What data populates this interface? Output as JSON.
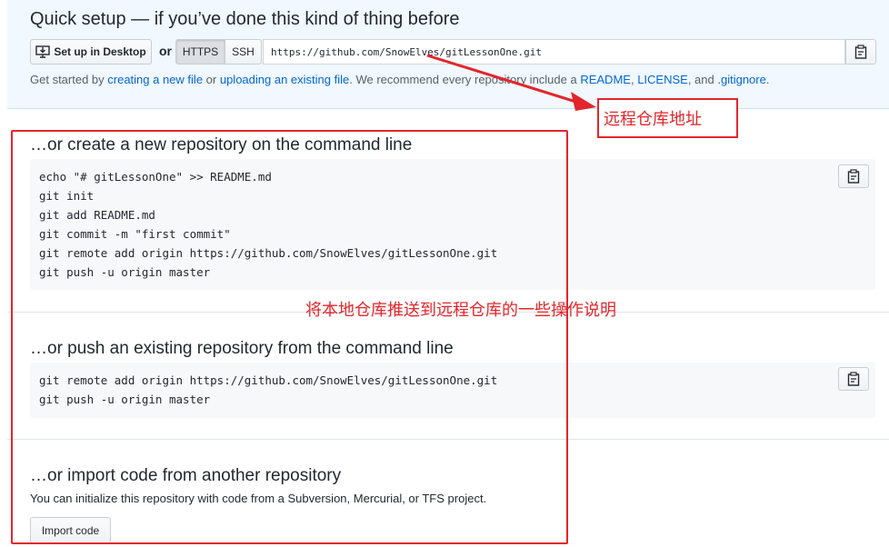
{
  "quick_setup": {
    "title": "Quick setup — if you’ve done this kind of thing before",
    "desktop_button": "Set up in Desktop",
    "or": "or",
    "https_label": "HTTPS",
    "ssh_label": "SSH",
    "clone_url": "https://github.com/SnowElves/gitLessonOne.git",
    "help": {
      "part1": "Get started by ",
      "link_new_file": "creating a new file",
      "part2": " or ",
      "link_upload": "uploading an existing file",
      "part3": ". We recommend every repository include a ",
      "link_readme": "README",
      "part4": ", ",
      "link_license": "LICENSE",
      "part5": ", and ",
      "link_gitignore": ".gitignore",
      "part6": "."
    }
  },
  "create_section": {
    "title": "…or create a new repository on the command line",
    "lines": [
      "echo \"# gitLessonOne\" >> README.md",
      "git init",
      "git add README.md",
      "git commit -m \"first commit\"",
      "git remote add origin https://github.com/SnowElves/gitLessonOne.git",
      "git push -u origin master"
    ]
  },
  "push_section": {
    "title": "…or push an existing repository from the command line",
    "lines": [
      "git remote add origin https://github.com/SnowElves/gitLessonOne.git",
      "git push -u origin master"
    ]
  },
  "import_section": {
    "title": "…or import code from another repository",
    "help": "You can initialize this repository with code from a Subversion, Mercurial, or TFS project.",
    "button": "Import code"
  },
  "annotations": {
    "remote_url_label": "远程仓库地址",
    "push_ops_label": "将本地仓库推送到远程仓库的一些操作说明",
    "color": "#e3262b"
  },
  "colors": {
    "link": "#0366d6",
    "quick_setup_bg": "#f1f8ff",
    "code_bg": "#f6f8fa"
  },
  "icons": {
    "desktop": "desktop-download-icon",
    "clipboard": "clipboard-icon"
  }
}
